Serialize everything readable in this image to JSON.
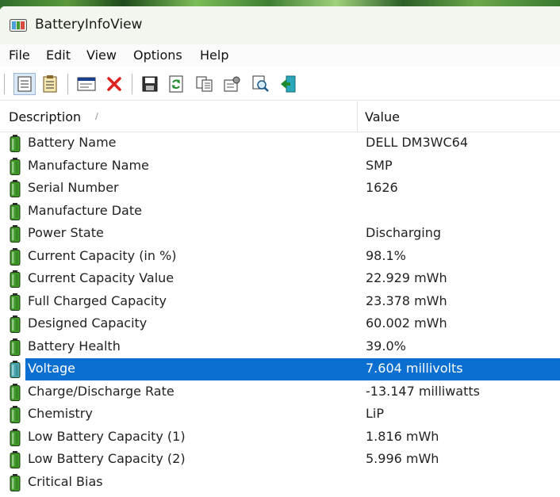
{
  "window": {
    "title": "BatteryInfoView",
    "app_icon": "battery-app-icon"
  },
  "menu": [
    "File",
    "Edit",
    "View",
    "Options",
    "Help"
  ],
  "toolbar": {
    "buttons": [
      "details-view-icon",
      "multi-view-icon",
      "properties-icon",
      "delete-icon",
      "save-icon",
      "refresh-icon",
      "copy-icon",
      "options-icon",
      "find-icon",
      "exit-icon"
    ]
  },
  "list": {
    "columns": {
      "description": "Description",
      "value": "Value"
    },
    "rows": [
      {
        "description": "Battery Name",
        "value": "DELL DM3WC64"
      },
      {
        "description": "Manufacture Name",
        "value": "SMP"
      },
      {
        "description": "Serial Number",
        "value": "1626"
      },
      {
        "description": "Manufacture Date",
        "value": ""
      },
      {
        "description": "Power State",
        "value": "Discharging"
      },
      {
        "description": "Current Capacity (in %)",
        "value": "98.1%"
      },
      {
        "description": "Current Capacity Value",
        "value": "22.929 mWh"
      },
      {
        "description": "Full Charged Capacity",
        "value": "23.378 mWh"
      },
      {
        "description": "Designed Capacity",
        "value": "60.002 mWh"
      },
      {
        "description": "Battery Health",
        "value": "39.0%"
      },
      {
        "description": "Voltage",
        "value": "7.604 millivolts"
      },
      {
        "description": "Charge/Discharge Rate",
        "value": "-13.147 milliwatts"
      },
      {
        "description": "Chemistry",
        "value": "LiP"
      },
      {
        "description": "Low Battery Capacity (1)",
        "value": "1.816 mWh"
      },
      {
        "description": "Low Battery Capacity (2)",
        "value": "5.996 mWh"
      },
      {
        "description": "Critical Bias",
        "value": ""
      }
    ],
    "selected_index": 10
  },
  "colors": {
    "selection": "#0a6fd0",
    "battery_green": "#3f9a2a",
    "battery_selected": "#4aa6b0"
  }
}
